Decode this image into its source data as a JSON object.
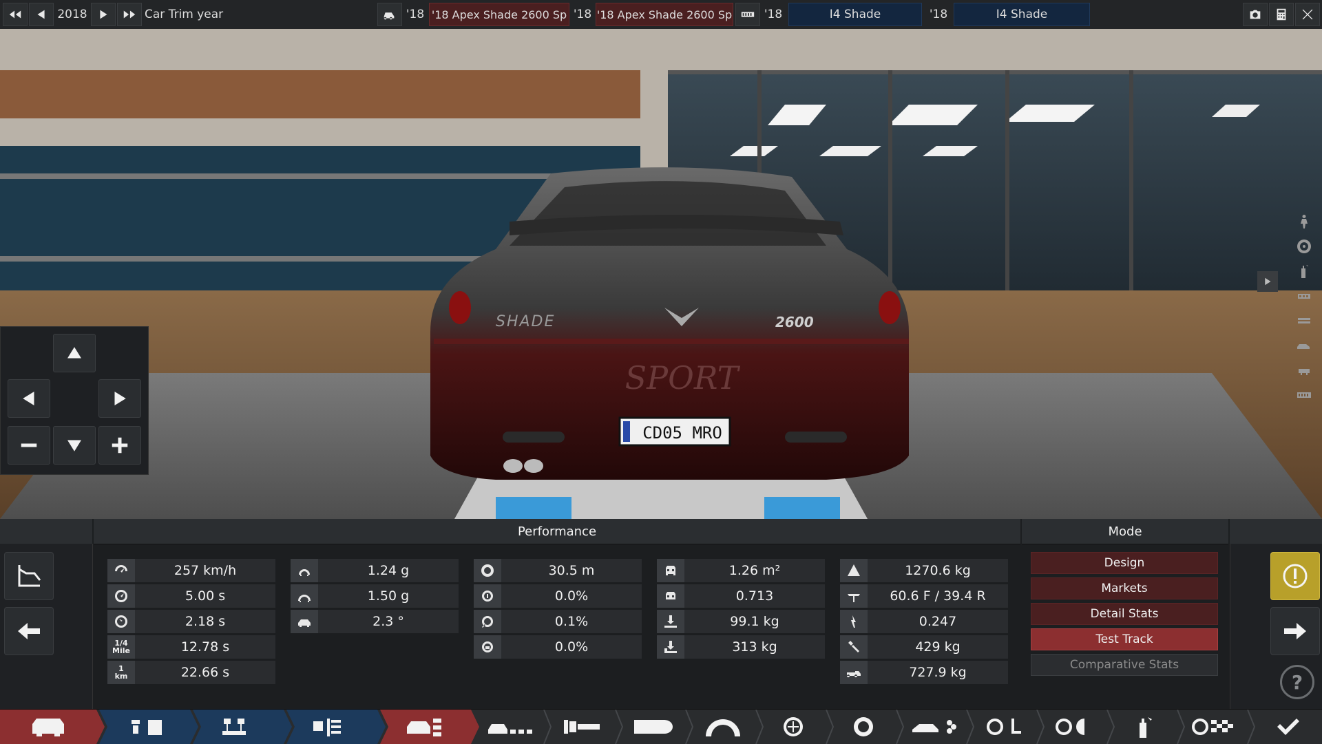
{
  "topbar": {
    "year_label": "2018",
    "trim_year_label": "Car Trim year",
    "compare_left": {
      "year_short": "'18",
      "model_name": "'18 Apex Shade 2600 Sp",
      "trim_year_short": "'18",
      "trim_name": "'18 Apex Shade 2600 Sp"
    },
    "compare_right": {
      "year_short": "'18",
      "engine_name": "I4 Shade",
      "engine_year_short": "'18",
      "engine_trim_name": "I4 Shade"
    }
  },
  "scene": {
    "plate_text": "CD05 MRO",
    "badge_left": "SHADE",
    "badge_right": "2600",
    "sport_text": "SPORT"
  },
  "performance": {
    "title": "Performance",
    "col1": [
      {
        "icon": "speedometer-icon",
        "value": "257 km/h"
      },
      {
        "icon": "acceleration-icon",
        "value": "5.00 s"
      },
      {
        "icon": "gauge-icon",
        "value": "2.18 s"
      },
      {
        "icon": "quarter-mile-icon",
        "label": "1/4 Mile",
        "value": "12.78 s"
      },
      {
        "icon": "kilometer-icon",
        "label": "1 km",
        "value": "22.66 s"
      }
    ],
    "col2": [
      {
        "icon": "cornering-icon",
        "value": "1.24 g"
      },
      {
        "icon": "cornering-max-icon",
        "value": "1.50 g"
      },
      {
        "icon": "body-roll-icon",
        "value": "2.3 °"
      }
    ],
    "col3": [
      {
        "icon": "braking-distance-icon",
        "value": "30.5 m"
      },
      {
        "icon": "brake-fade-icon",
        "value": "0.0%"
      },
      {
        "icon": "wheel-slip-icon",
        "value": "0.1%"
      },
      {
        "icon": "brake-lock-icon",
        "value": "0.0%"
      }
    ],
    "col4": [
      {
        "icon": "frontal-area-icon",
        "value": "1.26 m²"
      },
      {
        "icon": "drag-icon",
        "value": "0.713"
      },
      {
        "icon": "front-downforce-icon",
        "value": "99.1 kg"
      },
      {
        "icon": "rear-downforce-icon",
        "value": "313 kg"
      }
    ],
    "col5": [
      {
        "icon": "weight-icon",
        "value": "1270.6 kg"
      },
      {
        "icon": "weight-distribution-icon",
        "value": "60.6 F / 39.4 R"
      },
      {
        "icon": "lift-icon",
        "value": "0.247"
      },
      {
        "icon": "tools-icon",
        "value": "429 kg"
      },
      {
        "icon": "towing-icon",
        "value": "727.9 kg"
      }
    ]
  },
  "mode": {
    "title": "Mode",
    "buttons": [
      {
        "label": "Design",
        "state": "normal"
      },
      {
        "label": "Markets",
        "state": "normal"
      },
      {
        "label": "Detail Stats",
        "state": "normal"
      },
      {
        "label": "Test Track",
        "state": "selected"
      },
      {
        "label": "Comparative Stats",
        "state": "disabled"
      }
    ]
  },
  "colors": {
    "accent_red": "#8c2f30",
    "warning_yellow": "#b8a02a",
    "dark_bg": "#1c1e20"
  }
}
